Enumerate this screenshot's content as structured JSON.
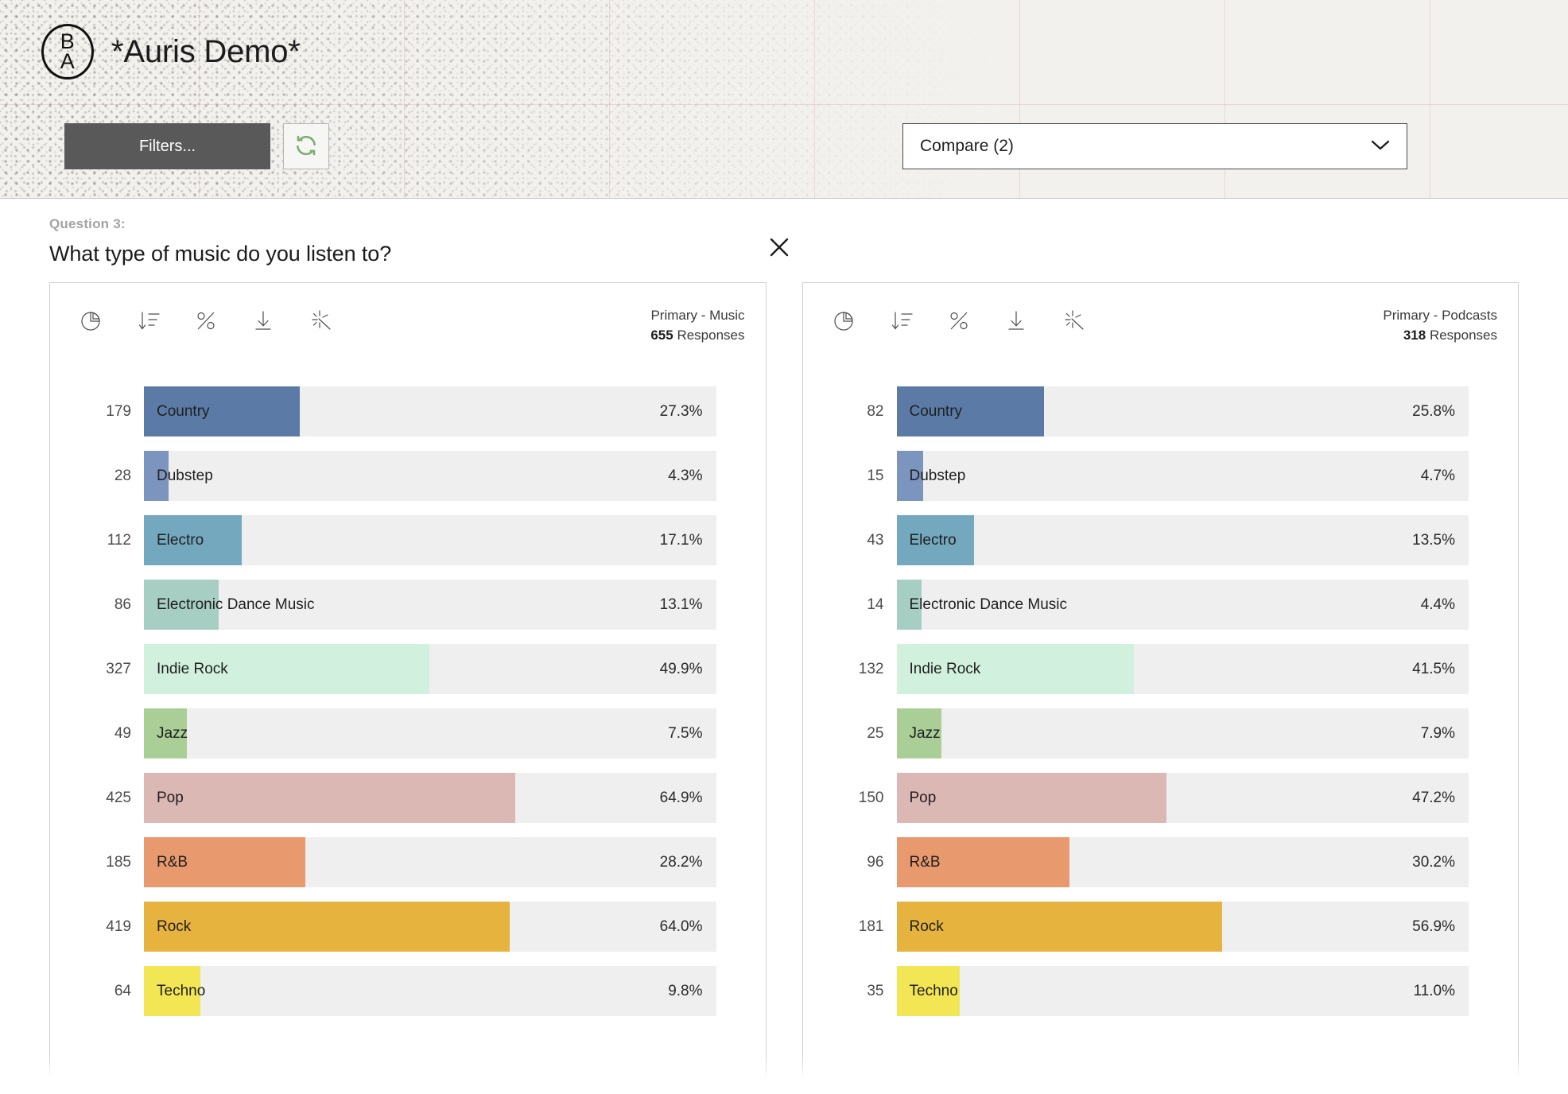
{
  "header": {
    "logo_top": "B",
    "logo_bottom": "A",
    "title": "*Auris Demo*",
    "filters_label": "Filters...",
    "refresh_icon": "refresh-icon",
    "compare_label": "Compare (2)",
    "chevron_icon": "chevron-down-icon"
  },
  "question": {
    "number": "Question 3:",
    "text": "What type of music do you listen to?",
    "close_icon": "close-icon"
  },
  "toolbar": {
    "icons": [
      {
        "name": "pie-chart-icon"
      },
      {
        "name": "sort-descending-icon"
      },
      {
        "name": "percent-icon"
      },
      {
        "name": "download-icon"
      },
      {
        "name": "significance-sparkle-icon"
      }
    ]
  },
  "colors": {
    "accent_filters": "#595959",
    "refresh_green": "#7fad72",
    "track": "#efefef",
    "panel_border": "#cfcfcf",
    "series": [
      "#5b7ba6",
      "#7b95bf",
      "#74a8bf",
      "#a6cec2",
      "#d2f0de",
      "#a9cf97",
      "#dcb8b4",
      "#e89a6e",
      "#e7b33f",
      "#f3e654"
    ]
  },
  "chart_data": [
    {
      "type": "bar",
      "title": "Primary - Music",
      "responses_count": "655",
      "responses_label": "Responses",
      "orientation": "horizontal",
      "xlabel": "",
      "ylabel": "",
      "xlim": [
        0,
        100
      ],
      "grid": false,
      "categories": [
        "Country",
        "Dubstep",
        "Electro",
        "Electronic Dance Music",
        "Indie Rock",
        "Jazz",
        "Pop",
        "R&B",
        "Rock",
        "Techno"
      ],
      "counts": [
        179,
        28,
        112,
        86,
        327,
        49,
        425,
        185,
        419,
        64
      ],
      "values": [
        27.3,
        4.3,
        17.1,
        13.1,
        49.9,
        7.5,
        64.9,
        28.2,
        64.0,
        9.8
      ],
      "count_labels": [
        "179",
        "28",
        "112",
        "86",
        "327",
        "49",
        "425",
        "185",
        "419",
        "64"
      ],
      "value_labels": [
        "27.3%",
        "4.3%",
        "17.1%",
        "13.1%",
        "49.9%",
        "7.5%",
        "64.9%",
        "28.2%",
        "64.0%",
        "9.8%"
      ],
      "colors": [
        "#5b7ba6",
        "#7b95bf",
        "#74a8bf",
        "#a6cec2",
        "#d2f0de",
        "#a9cf97",
        "#dcb8b4",
        "#e89a6e",
        "#e7b33f",
        "#f3e654"
      ]
    },
    {
      "type": "bar",
      "title": "Primary - Podcasts",
      "responses_count": "318",
      "responses_label": "Responses",
      "orientation": "horizontal",
      "xlabel": "",
      "ylabel": "",
      "xlim": [
        0,
        100
      ],
      "grid": false,
      "categories": [
        "Country",
        "Dubstep",
        "Electro",
        "Electronic Dance Music",
        "Indie Rock",
        "Jazz",
        "Pop",
        "R&B",
        "Rock",
        "Techno"
      ],
      "counts": [
        82,
        15,
        43,
        14,
        132,
        25,
        150,
        96,
        181,
        35
      ],
      "values": [
        25.8,
        4.7,
        13.5,
        4.4,
        41.5,
        7.9,
        47.2,
        30.2,
        56.9,
        11.0
      ],
      "count_labels": [
        "82",
        "15",
        "43",
        "14",
        "132",
        "25",
        "150",
        "96",
        "181",
        "35"
      ],
      "value_labels": [
        "25.8%",
        "4.7%",
        "13.5%",
        "4.4%",
        "41.5%",
        "7.9%",
        "47.2%",
        "30.2%",
        "56.9%",
        "11.0%"
      ],
      "colors": [
        "#5b7ba6",
        "#7b95bf",
        "#74a8bf",
        "#a6cec2",
        "#d2f0de",
        "#a9cf97",
        "#dcb8b4",
        "#e89a6e",
        "#e7b33f",
        "#f3e654"
      ]
    }
  ]
}
